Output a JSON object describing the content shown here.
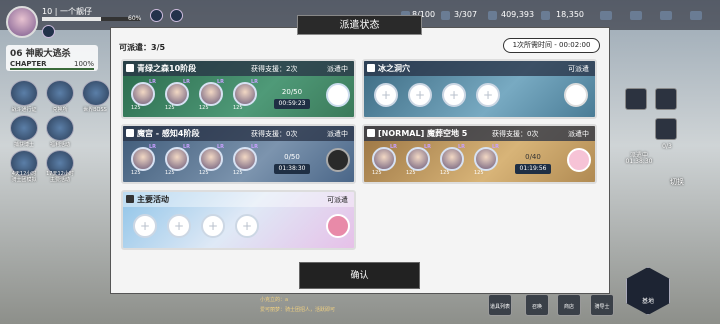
{
  "player": {
    "level": "10",
    "name": "一个靓仔",
    "exp_pct": "60%",
    "exp_value": 0.6
  },
  "chapter": {
    "title": "06 神殿大逃杀",
    "label": "CHAPTER",
    "percent": "100%"
  },
  "resources": [
    {
      "value": "8/100"
    },
    {
      "value": "3/307"
    },
    {
      "value": "409,393"
    },
    {
      "value": "18,350"
    }
  ],
  "left_icons": [
    {
      "label": "战斗通行证"
    },
    {
      "label": "兑换所"
    },
    {
      "label": "世界BOSS"
    },
    {
      "label": "捕获博士"
    },
    {
      "label": "福利活动"
    },
    {
      "label": "4天12小时"
    },
    {
      "label": "17天12小时"
    }
  ],
  "left_sub": [
    {
      "label": "骑士团模拟"
    },
    {
      "label": "主要活动"
    }
  ],
  "right_panel": {
    "status": "派遣中",
    "time": "01:38:30",
    "count": "0/3",
    "switch": "切换"
  },
  "modal": {
    "title": "派遣状态",
    "available": "可派遣：3/5",
    "time_needed": "1次所需时间 - 00:02:00",
    "confirm": "确认",
    "cards": [
      {
        "name": "青绿之森10阶段",
        "support": "获得支援：2次",
        "status": "派遣中",
        "progress": "20/50",
        "time": "00:59:23",
        "heroes": [
          "LR",
          "LR",
          "LR",
          "LR"
        ],
        "levels": [
          "125",
          "125",
          "125",
          "125"
        ]
      },
      {
        "name": "冰之洞穴",
        "status": "可派遣"
      },
      {
        "name": "魔宫 - 感知4阶段",
        "support": "获得支援：0次",
        "status": "派遣中",
        "progress": "0/50",
        "time": "01:38:30",
        "heroes": [
          "LR",
          "LR",
          "LR",
          "LR"
        ],
        "levels": [
          "125",
          "125",
          "125",
          "125"
        ]
      },
      {
        "name": "[NORMAL] 魔葬空地 5",
        "support": "获得支援：0次",
        "status": "派遣中",
        "progress": "0/40",
        "time": "01:19:56",
        "heroes": [
          "LR",
          "LR",
          "LR",
          "LR"
        ],
        "levels": [
          "125",
          "125",
          "125",
          "125"
        ]
      },
      {
        "name": "主要活动",
        "status": "可派遣"
      }
    ]
  },
  "chat": [
    {
      "user": "小克立的：",
      "text": "a"
    },
    {
      "user": "爱可丽梦：",
      "text": "骑士团招人，活跃即可"
    }
  ],
  "bottom": [
    {
      "label": "道具列表"
    },
    {
      "label": "召唤"
    },
    {
      "label": "商店"
    },
    {
      "label": "骑导士"
    }
  ],
  "base_label": "基地",
  "colors": {
    "modal_bg": "#f4f4f4",
    "title_bg": "#2a2a2a",
    "card_green": "#2f6a4a",
    "card_ice": "#3c6a82",
    "card_gold": "#b58a4a",
    "card_event": "#8fc4e8"
  }
}
